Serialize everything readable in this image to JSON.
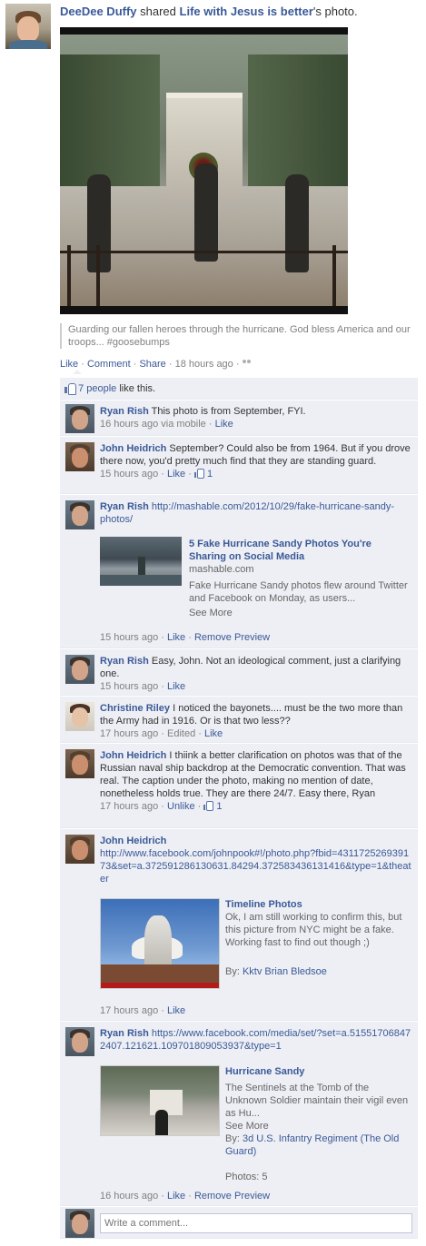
{
  "story": {
    "actor": "DeeDee Duffy",
    "verb": " shared ",
    "target": "Life with Jesus is better",
    "suffix": "'s photo.",
    "caption": "Guarding our fallen heroes through the hurricane. God bless America and our troops... #goosebumps",
    "actions": {
      "like": "Like",
      "comment": "Comment",
      "share": "Share",
      "time": "18 hours ago",
      "sep": " · "
    }
  },
  "likes": {
    "count_text": "7 people",
    "suffix": " like this."
  },
  "comments": [
    {
      "author": "Ryan Rish",
      "text": "This photo is from September, FYI.",
      "time": "16 hours ago via mobile",
      "actions": [
        "Like"
      ]
    },
    {
      "author": "John Heidrich",
      "text": "September? Could also be from 1964. But if you drove there now, you'd pretty much find that they are standing guard.",
      "time": "15 hours ago",
      "actions": [
        "Like"
      ],
      "likes": "1"
    },
    {
      "author": "Ryan Rish",
      "link": "http://mashable.com/2012/10/29/fake-hurricane-sandy-photos/",
      "preview": {
        "title": "5 Fake Hurricane Sandy Photos You're Sharing on Social Media",
        "domain": "mashable.com",
        "desc": "Fake Hurricane Sandy photos flew around Twitter and Facebook on Monday, as users...",
        "more": "See More"
      },
      "time": "15 hours ago",
      "actions": [
        "Like",
        "Remove Preview"
      ]
    },
    {
      "author": "Ryan Rish",
      "text": "Easy, John. Not an ideological comment, just a clarifying one.",
      "time": "15 hours ago",
      "actions": [
        "Like"
      ]
    },
    {
      "author": "Christine Riley",
      "text": "I noticed the bayonets.... must be the two more than the Army had in 1916. Or is that two less??",
      "time": "17 hours ago",
      "edited": "Edited",
      "actions": [
        "Like"
      ]
    },
    {
      "author": "John Heidrich",
      "text": "I thiink a better clarification on photos was that of the Russian naval ship backdrop at the Democratic convention. That was real. The caption under the photo, making no mention of date, nonetheless holds true. They are there 24/7. Easy there, Ryan",
      "time": "17 hours ago",
      "actions": [
        "Unlike"
      ],
      "likes": "1"
    },
    {
      "author": "John Heidrich",
      "link": "http://www.facebook.com/johnpook#!/photo.php?fbid=431172526939173&set=a.372591286130631.84294.372583436131416&type=1&theater",
      "preview": {
        "title": "Timeline Photos",
        "desc": "Ok, I am still working to confirm this, but this picture from NYC might be a fake. Working fast to find out though ;)",
        "by_label": "By: ",
        "by": "Kktv Brian Bledsoe"
      },
      "time": "17 hours ago",
      "actions": [
        "Like"
      ]
    },
    {
      "author": "Ryan Rish",
      "link": "https://www.facebook.com/media/set/?set=a.515517068472407.121621.109701809053937&type=1",
      "preview": {
        "title": "Hurricane Sandy",
        "desc": "The Sentinels at the Tomb of the Unknown Soldier maintain their vigil even as Hu...",
        "more": "See More",
        "by_label": "By: ",
        "by": "3d U.S. Infantry Regiment (The Old Guard)",
        "photos": "Photos: 5"
      },
      "time": "16 hours ago",
      "actions": [
        "Like",
        "Remove Preview"
      ]
    }
  ],
  "composer": {
    "placeholder": "Write a comment..."
  },
  "colors": {
    "link": "#3b5998",
    "ufi_bg": "#edeff4",
    "meta": "#808080"
  }
}
